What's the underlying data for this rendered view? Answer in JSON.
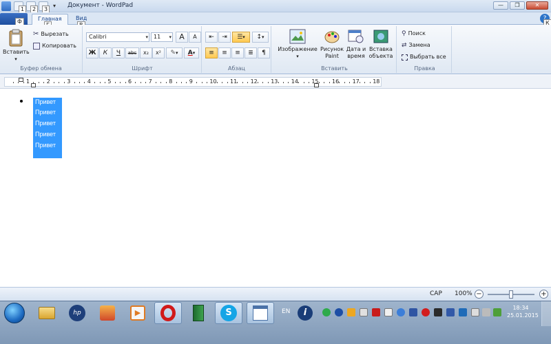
{
  "window": {
    "title": "Документ - WordPad",
    "minimize": "—",
    "maximize": "❐",
    "close": "✕"
  },
  "quick_access": {
    "keytips": [
      "1",
      "2",
      "3"
    ],
    "more": "▾"
  },
  "ribbon_tabs": {
    "file_keytip": "Ф",
    "home": "Главная",
    "home_keytip": "Г",
    "view": "Вид",
    "view_keytip": "В",
    "help_keytip": "К",
    "help_icon": "?"
  },
  "clipboard": {
    "label": "Буфер обмена",
    "paste": "Вставить",
    "cut": "Вырезать",
    "copy": "Копировать"
  },
  "font": {
    "label": "Шрифт",
    "family": "Calibri",
    "size": "11",
    "grow": "A",
    "shrink": "A",
    "bold": "Ж",
    "italic": "К",
    "underline": "Ч",
    "strike": "abc",
    "subscript": "x₂",
    "superscript": "x²"
  },
  "paragraph": {
    "label": "Абзац"
  },
  "insert": {
    "label": "Вставить",
    "image": "Изображение",
    "paint_1": "Рисунок",
    "paint_2": "Paint",
    "datetime_1": "Дата и",
    "datetime_2": "время",
    "object_1": "Вставка",
    "object_2": "объекта"
  },
  "editing": {
    "label": "Правка",
    "find": "Поиск",
    "replace": "Замена",
    "select_all": "Выбрать все"
  },
  "ruler": {
    "numbers": [
      "1",
      "2",
      "3",
      "4",
      "5",
      "6",
      "7",
      "8",
      "9",
      "10",
      "11",
      "12",
      "13",
      "14",
      "15",
      "16",
      "17",
      "18"
    ]
  },
  "document": {
    "lines": [
      "Привет",
      "Привет",
      "Привет",
      "Привет",
      "Привет"
    ]
  },
  "statusbar": {
    "caps": "CAP",
    "zoom": "100%",
    "zoom_out": "−",
    "zoom_in": "+"
  },
  "taskbar": {
    "language": "EN",
    "time": "18:34",
    "date": "25.01.2015"
  }
}
